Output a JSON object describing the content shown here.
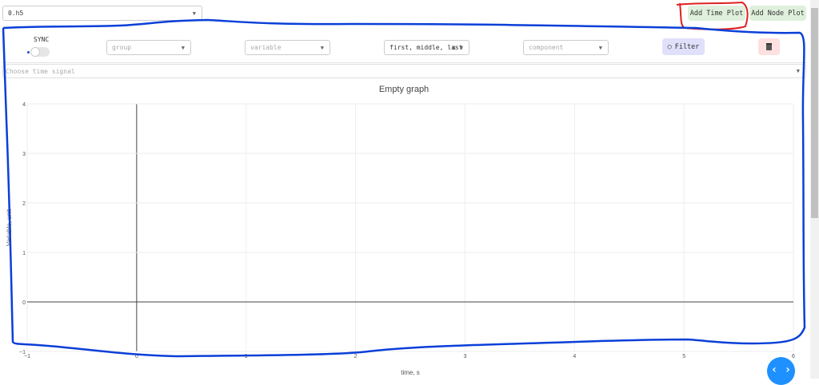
{
  "file_select": {
    "value": "0.h5"
  },
  "header_buttons": {
    "add_time_plot": "Add Time Plot",
    "add_node_plot": "Add Node Plot"
  },
  "controls": {
    "sync_label": "SYNC",
    "group_placeholder": "group",
    "variable_placeholder": "variable",
    "selection_value": "first, middle, last",
    "clear_symbol": "x",
    "component_placeholder": "component",
    "filter_label": "Filter",
    "time_signal_placeholder": "Choose time signal"
  },
  "colors": {
    "accent_green": "#dff0dc",
    "filter_bg": "#e0e0fb",
    "delete_bg": "#fde0e0",
    "annotation_red": "#e02020",
    "annotation_blue": "#0a3fd8",
    "fab": "#1e90ff"
  },
  "chart_data": {
    "type": "line",
    "title": "Empty graph",
    "xlabel": "time, s",
    "ylabel": "Variable, unit",
    "xlim": [
      -1,
      6
    ],
    "ylim": [
      -1,
      4
    ],
    "xticks": [
      -1,
      0,
      1,
      2,
      3,
      4,
      5,
      6
    ],
    "yticks": [
      -1,
      0,
      1,
      2,
      3,
      4
    ],
    "series": [],
    "grid": true
  }
}
